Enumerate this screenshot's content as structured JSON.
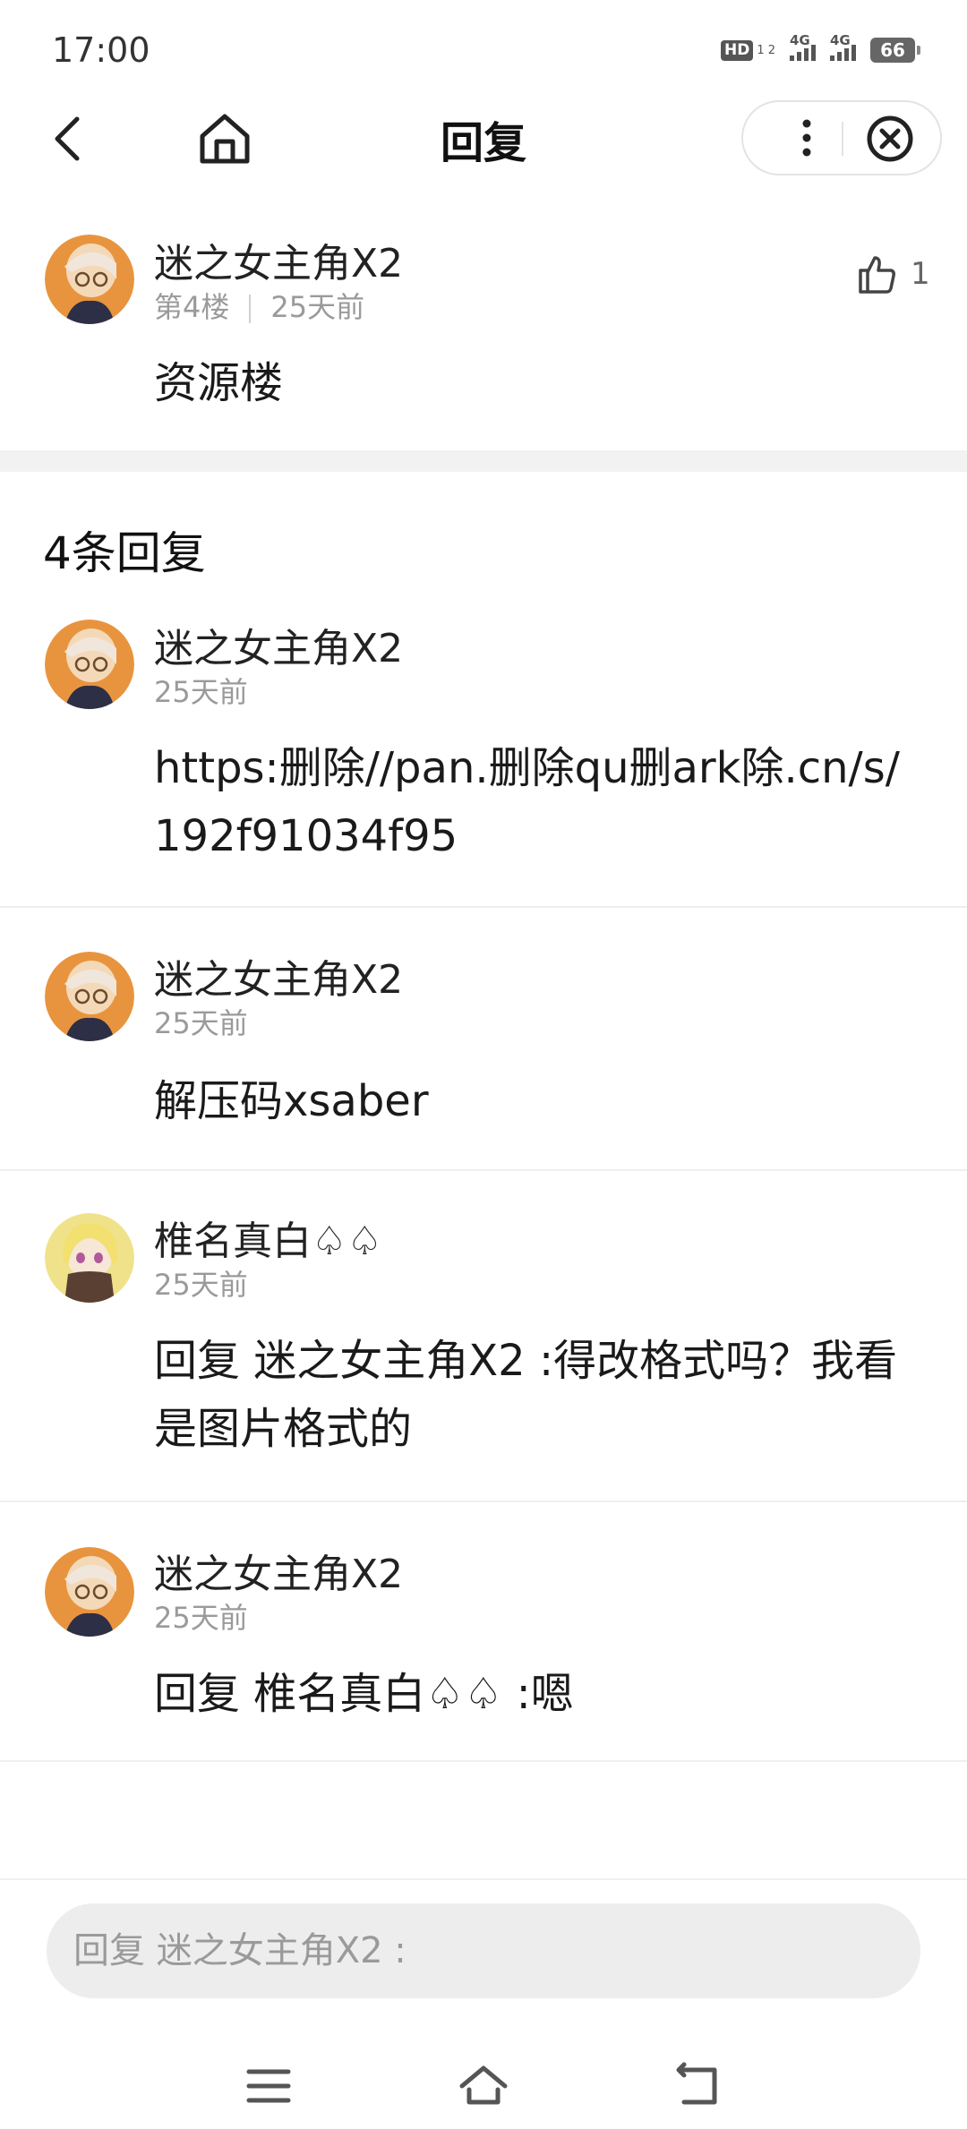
{
  "status_bar": {
    "time": "17:00",
    "hd_label": "HD",
    "hd_sub": "1 2",
    "network_1": "4G",
    "network_2": "4G",
    "battery": "66"
  },
  "header": {
    "title": "回复",
    "back_icon": "chevron-left-icon",
    "home_icon": "home-icon",
    "more_icon": "more-vertical-icon",
    "close_icon": "close-circle-icon"
  },
  "main_comment": {
    "username": "迷之女主角X2",
    "floor": "第4楼",
    "time": "25天前",
    "content": "资源楼",
    "likes": "1",
    "like_icon": "thumb-up-icon"
  },
  "replies_header": "4条回复",
  "replies": [
    {
      "username": "迷之女主角X2",
      "time": "25天前",
      "content": "https:删除//pan.删除qu删ark除.cn/s/192f91034f95"
    },
    {
      "username": "迷之女主角X2",
      "time": "25天前",
      "content": "解压码xsaber"
    },
    {
      "username": "椎名真白♤♤",
      "time": "25天前",
      "content": "回复 迷之女主角X2 :得改格式吗？我看是图片格式的"
    },
    {
      "username": "迷之女主角X2",
      "time": "25天前",
      "content": "回复 椎名真白♤♤ :嗯"
    }
  ],
  "reply_input": {
    "placeholder": "回复 迷之女主角X2 :"
  },
  "nav_keys": {
    "menu_icon": "menu-icon",
    "home_icon": "home-outline-icon",
    "back_icon": "back-icon"
  },
  "colors": {
    "avatar_orange": "#e8943f",
    "avatar_blonde": "#efe28a",
    "input_bg": "#ededed",
    "secondary_text": "#9a9a9a"
  }
}
